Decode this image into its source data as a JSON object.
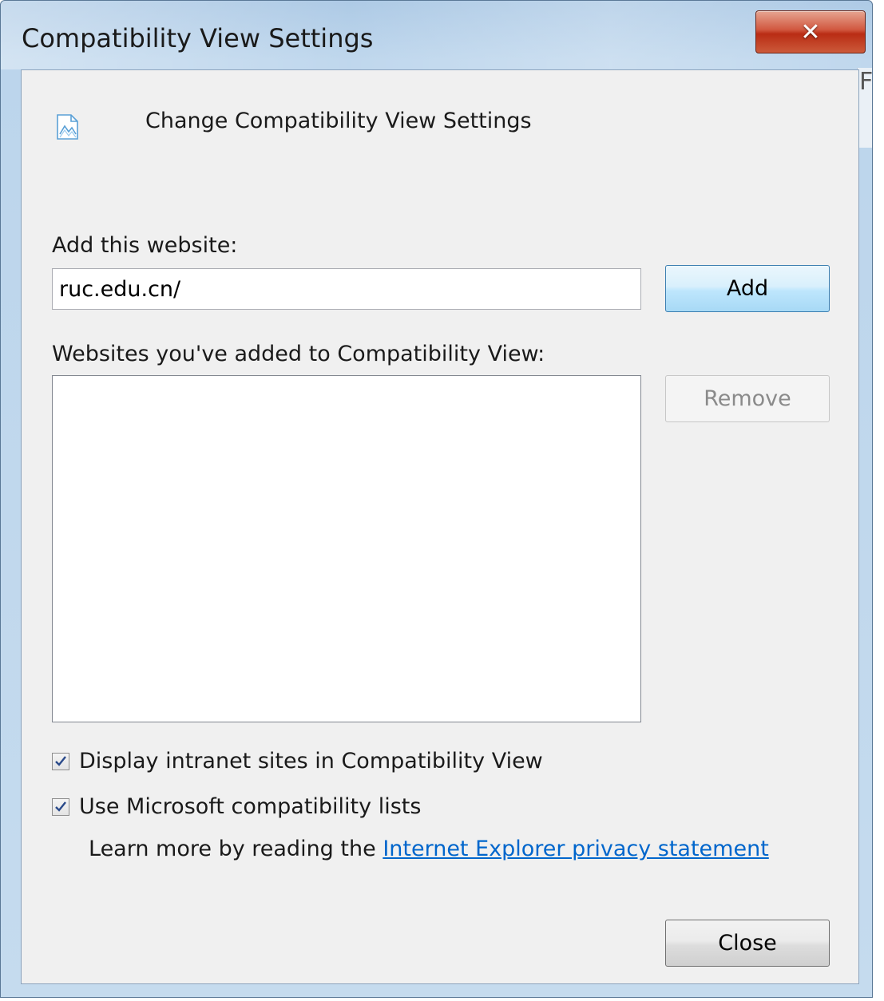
{
  "window": {
    "title": "Compatibility View Settings",
    "close_glyph": "✕",
    "behind_glyph": "Fi"
  },
  "header": {
    "icon": "compatibility-view-icon",
    "text": "Change Compatibility View Settings"
  },
  "add_section": {
    "label": "Add this website:",
    "value": "ruc.edu.cn/",
    "add_label": "Add"
  },
  "list_section": {
    "label": "Websites you've added to Compatibility View:",
    "items": [],
    "remove_label": "Remove"
  },
  "options": {
    "intranet_label": "Display intranet sites in Compatibility View",
    "intranet_checked": true,
    "ms_lists_label": "Use Microsoft compatibility lists",
    "ms_lists_checked": true,
    "learn_prefix": "Learn more by reading the",
    "privacy_link": "Internet Explorer privacy statement"
  },
  "footer": {
    "close_label": "Close"
  },
  "colors": {
    "link": "#0066cc",
    "close_button": "#c9452c",
    "add_button": "#bee6fd"
  }
}
